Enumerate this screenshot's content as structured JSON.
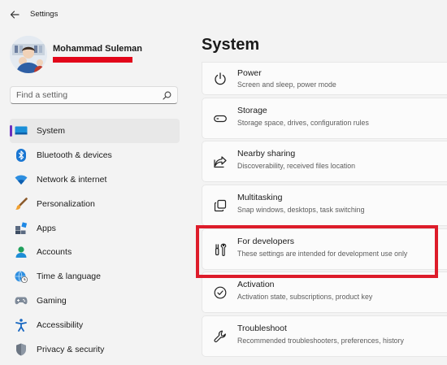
{
  "app": {
    "title": "Settings"
  },
  "user": {
    "name": "Mohammad Suleman"
  },
  "search": {
    "placeholder": "Find a setting"
  },
  "nav": {
    "items": [
      {
        "label": "System",
        "icon": "system-icon",
        "selected": true
      },
      {
        "label": "Bluetooth & devices",
        "icon": "bluetooth-icon"
      },
      {
        "label": "Network & internet",
        "icon": "wifi-icon"
      },
      {
        "label": "Personalization",
        "icon": "paintbrush-icon"
      },
      {
        "label": "Apps",
        "icon": "apps-icon"
      },
      {
        "label": "Accounts",
        "icon": "accounts-icon"
      },
      {
        "label": "Time & language",
        "icon": "globe-clock-icon"
      },
      {
        "label": "Gaming",
        "icon": "gamepad-icon"
      },
      {
        "label": "Accessibility",
        "icon": "accessibility-icon"
      },
      {
        "label": "Privacy & security",
        "icon": "shield-icon"
      }
    ]
  },
  "main": {
    "title": "System",
    "cards": [
      {
        "title": "Power",
        "subtitle": "Screen and sleep, power mode",
        "icon": "power-icon"
      },
      {
        "title": "Storage",
        "subtitle": "Storage space, drives, configuration rules",
        "icon": "storage-icon"
      },
      {
        "title": "Nearby sharing",
        "subtitle": "Discoverability, received files location",
        "icon": "share-icon"
      },
      {
        "title": "Multitasking",
        "subtitle": "Snap windows, desktops, task switching",
        "icon": "multitasking-icon"
      },
      {
        "title": "For developers",
        "subtitle": "These settings are intended for development use only",
        "icon": "developer-tools-icon"
      },
      {
        "title": "Activation",
        "subtitle": "Activation state, subscriptions, product key",
        "icon": "activation-icon"
      },
      {
        "title": "Troubleshoot",
        "subtitle": "Recommended troubleshooters, preferences, history",
        "icon": "wrench-icon"
      }
    ]
  },
  "colors": {
    "accent": "#6b2fbd",
    "highlight": "#dd1c2a",
    "redaction": "#e2061a"
  }
}
